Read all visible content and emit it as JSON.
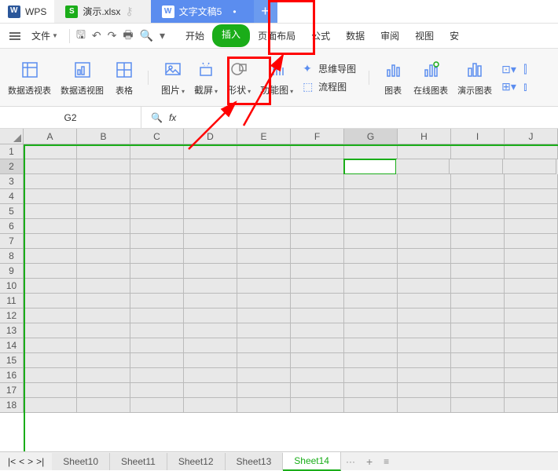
{
  "title_bar": {
    "app_name": "WPS",
    "tabs": [
      {
        "icon": "S",
        "label": "演示.xlsx",
        "active": true
      },
      {
        "icon": "W",
        "label": "文字文稿5",
        "doc2": true
      }
    ]
  },
  "menu_bar": {
    "file_label": "文件",
    "items": [
      "开始",
      "插入",
      "页面布局",
      "公式",
      "数据",
      "审阅",
      "视图",
      "安"
    ],
    "active_index": 1
  },
  "ribbon": {
    "groups": [
      {
        "label": "数据透视表",
        "arr": false
      },
      {
        "label": "数据透视图",
        "arr": false
      },
      {
        "label": "表格",
        "arr": false
      },
      {
        "label": "图片",
        "arr": true
      },
      {
        "label": "截屏",
        "arr": true
      },
      {
        "label": "形状",
        "arr": true
      },
      {
        "label": "功能图",
        "arr": true
      }
    ],
    "small_items": [
      {
        "label": "思维导图"
      },
      {
        "label": "流程图"
      }
    ],
    "groups2": [
      {
        "label": "图表",
        "arr": false
      },
      {
        "label": "在线图表",
        "arr": false
      },
      {
        "label": "演示图表",
        "arr": false
      }
    ]
  },
  "formula_bar": {
    "name_box": "G2",
    "fx": "fx"
  },
  "grid": {
    "columns": [
      "A",
      "B",
      "C",
      "D",
      "E",
      "F",
      "G",
      "H",
      "I",
      "J"
    ],
    "row_count": 18,
    "active_cell": {
      "row": 2,
      "col": "G"
    },
    "selected_col_index": 6,
    "selected_row_index": 1
  },
  "sheet_tabs": {
    "tabs": [
      "Sheet10",
      "Sheet11",
      "Sheet12",
      "Sheet13",
      "Sheet14"
    ],
    "active_index": 4
  }
}
